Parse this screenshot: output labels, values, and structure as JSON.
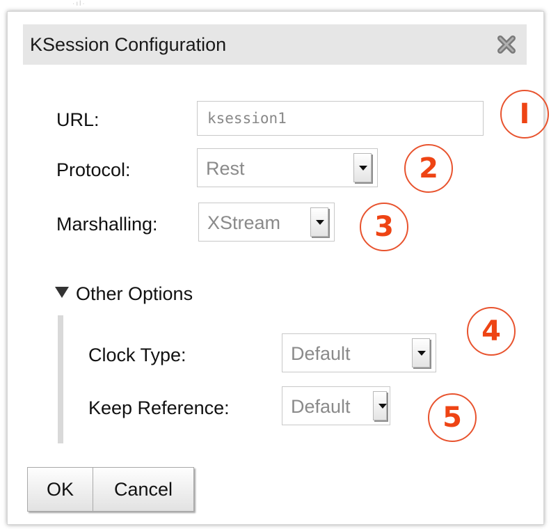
{
  "dialog": {
    "title": "KSession Configuration",
    "close_icon": "close-x-icon"
  },
  "fields": {
    "url_label": "URL:",
    "url_value": "ksession1",
    "protocol_label": "Protocol:",
    "protocol_value": "Rest",
    "marshalling_label": "Marshalling:",
    "marshalling_value": "XStream"
  },
  "other_options": {
    "header": "Other Options",
    "expanded": true,
    "clock_type_label": "Clock Type:",
    "clock_type_value": "Default",
    "keep_reference_label": "Keep Reference:",
    "keep_reference_value": "Default"
  },
  "callouts": [
    "I",
    "2",
    "3",
    "4",
    "5"
  ],
  "buttons": {
    "ok": "OK",
    "cancel": "Cancel"
  },
  "colors": {
    "titlebar": "#e6e6e6",
    "callout": "#ee4414"
  }
}
